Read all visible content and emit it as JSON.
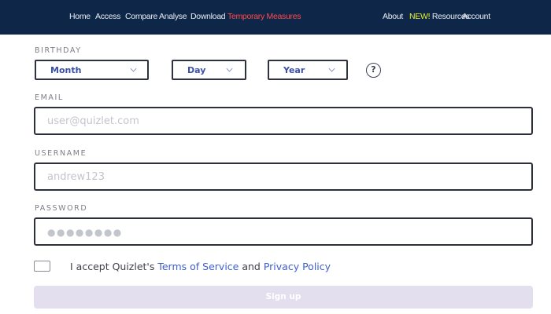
{
  "nav": {
    "left_items": [
      {
        "label": "Home"
      },
      {
        "label": "Access"
      },
      {
        "label": "Compare"
      },
      {
        "label": "Analyse"
      },
      {
        "label": "Download"
      },
      {
        "label": "Temporary Measures",
        "highlight_color": "#ff4a4a"
      }
    ],
    "right_items": {
      "about": "About",
      "resources_badge": "NEW!",
      "resources": " Resources",
      "account": "Account"
    },
    "background_color": "#0e2749"
  },
  "form": {
    "birthday": {
      "label": "BIRTHDAY",
      "month": "Month",
      "day": "Day",
      "year": "Year",
      "help_icon": "question-circle-icon",
      "help_glyph": "?"
    },
    "email": {
      "label": "EMAIL",
      "placeholder": "user@quizlet.com"
    },
    "username": {
      "label": "USERNAME",
      "placeholder": "andrew123"
    },
    "password": {
      "label": "PASSWORD",
      "masked_value": "●●●●●●●●"
    },
    "terms": {
      "prefix": "I accept Quizlet's ",
      "terms_link": "Terms of Service",
      "and": " and ",
      "privacy_link": "Privacy Policy",
      "link_color": "#3f5fcf"
    },
    "submit_label": "Sign up",
    "submit_color": "#e4dfee"
  }
}
